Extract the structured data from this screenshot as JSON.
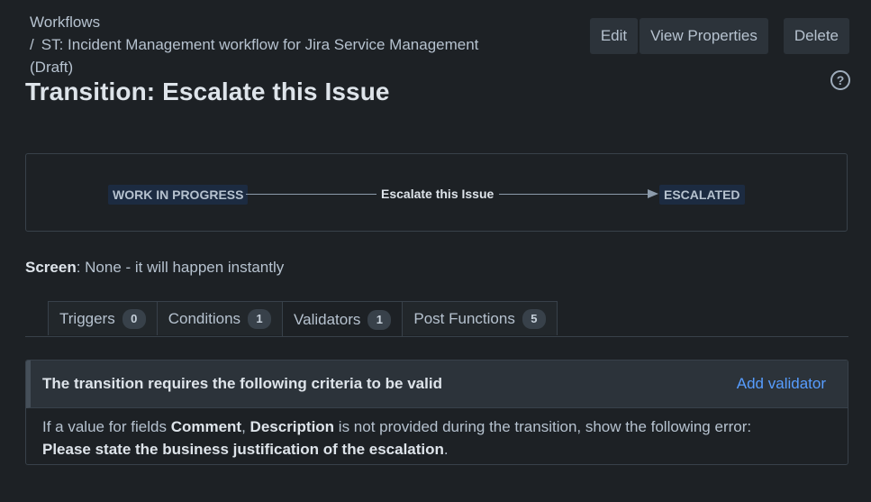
{
  "breadcrumb": {
    "root": "Workflows",
    "separator": "/",
    "workflow": "ST: Incident Management workflow for Jira Service Management",
    "state": "(Draft)"
  },
  "page_title": "Transition: Escalate this Issue",
  "actions": {
    "edit": "Edit",
    "view_properties": "View Properties",
    "delete": "Delete"
  },
  "help": "?",
  "diagram": {
    "from_status": "WORK IN PROGRESS",
    "transition": "Escalate this Issue",
    "to_status": "ESCALATED"
  },
  "screen": {
    "label": "Screen",
    "value": ": None - it will happen instantly"
  },
  "tabs": [
    {
      "label": "Triggers",
      "count": "0"
    },
    {
      "label": "Conditions",
      "count": "1"
    },
    {
      "label": "Validators",
      "count": "1"
    },
    {
      "label": "Post Functions",
      "count": "5"
    }
  ],
  "panel": {
    "title": "The transition requires the following criteria to be valid",
    "add_link": "Add validator",
    "body": {
      "t1": "If a value for fields ",
      "f1": "Comment",
      "t2": ", ",
      "f2": "Description",
      "t3": " is not provided during the transition, show the following error:",
      "error": "Please state the business justification of the escalation",
      "t4": "."
    }
  }
}
